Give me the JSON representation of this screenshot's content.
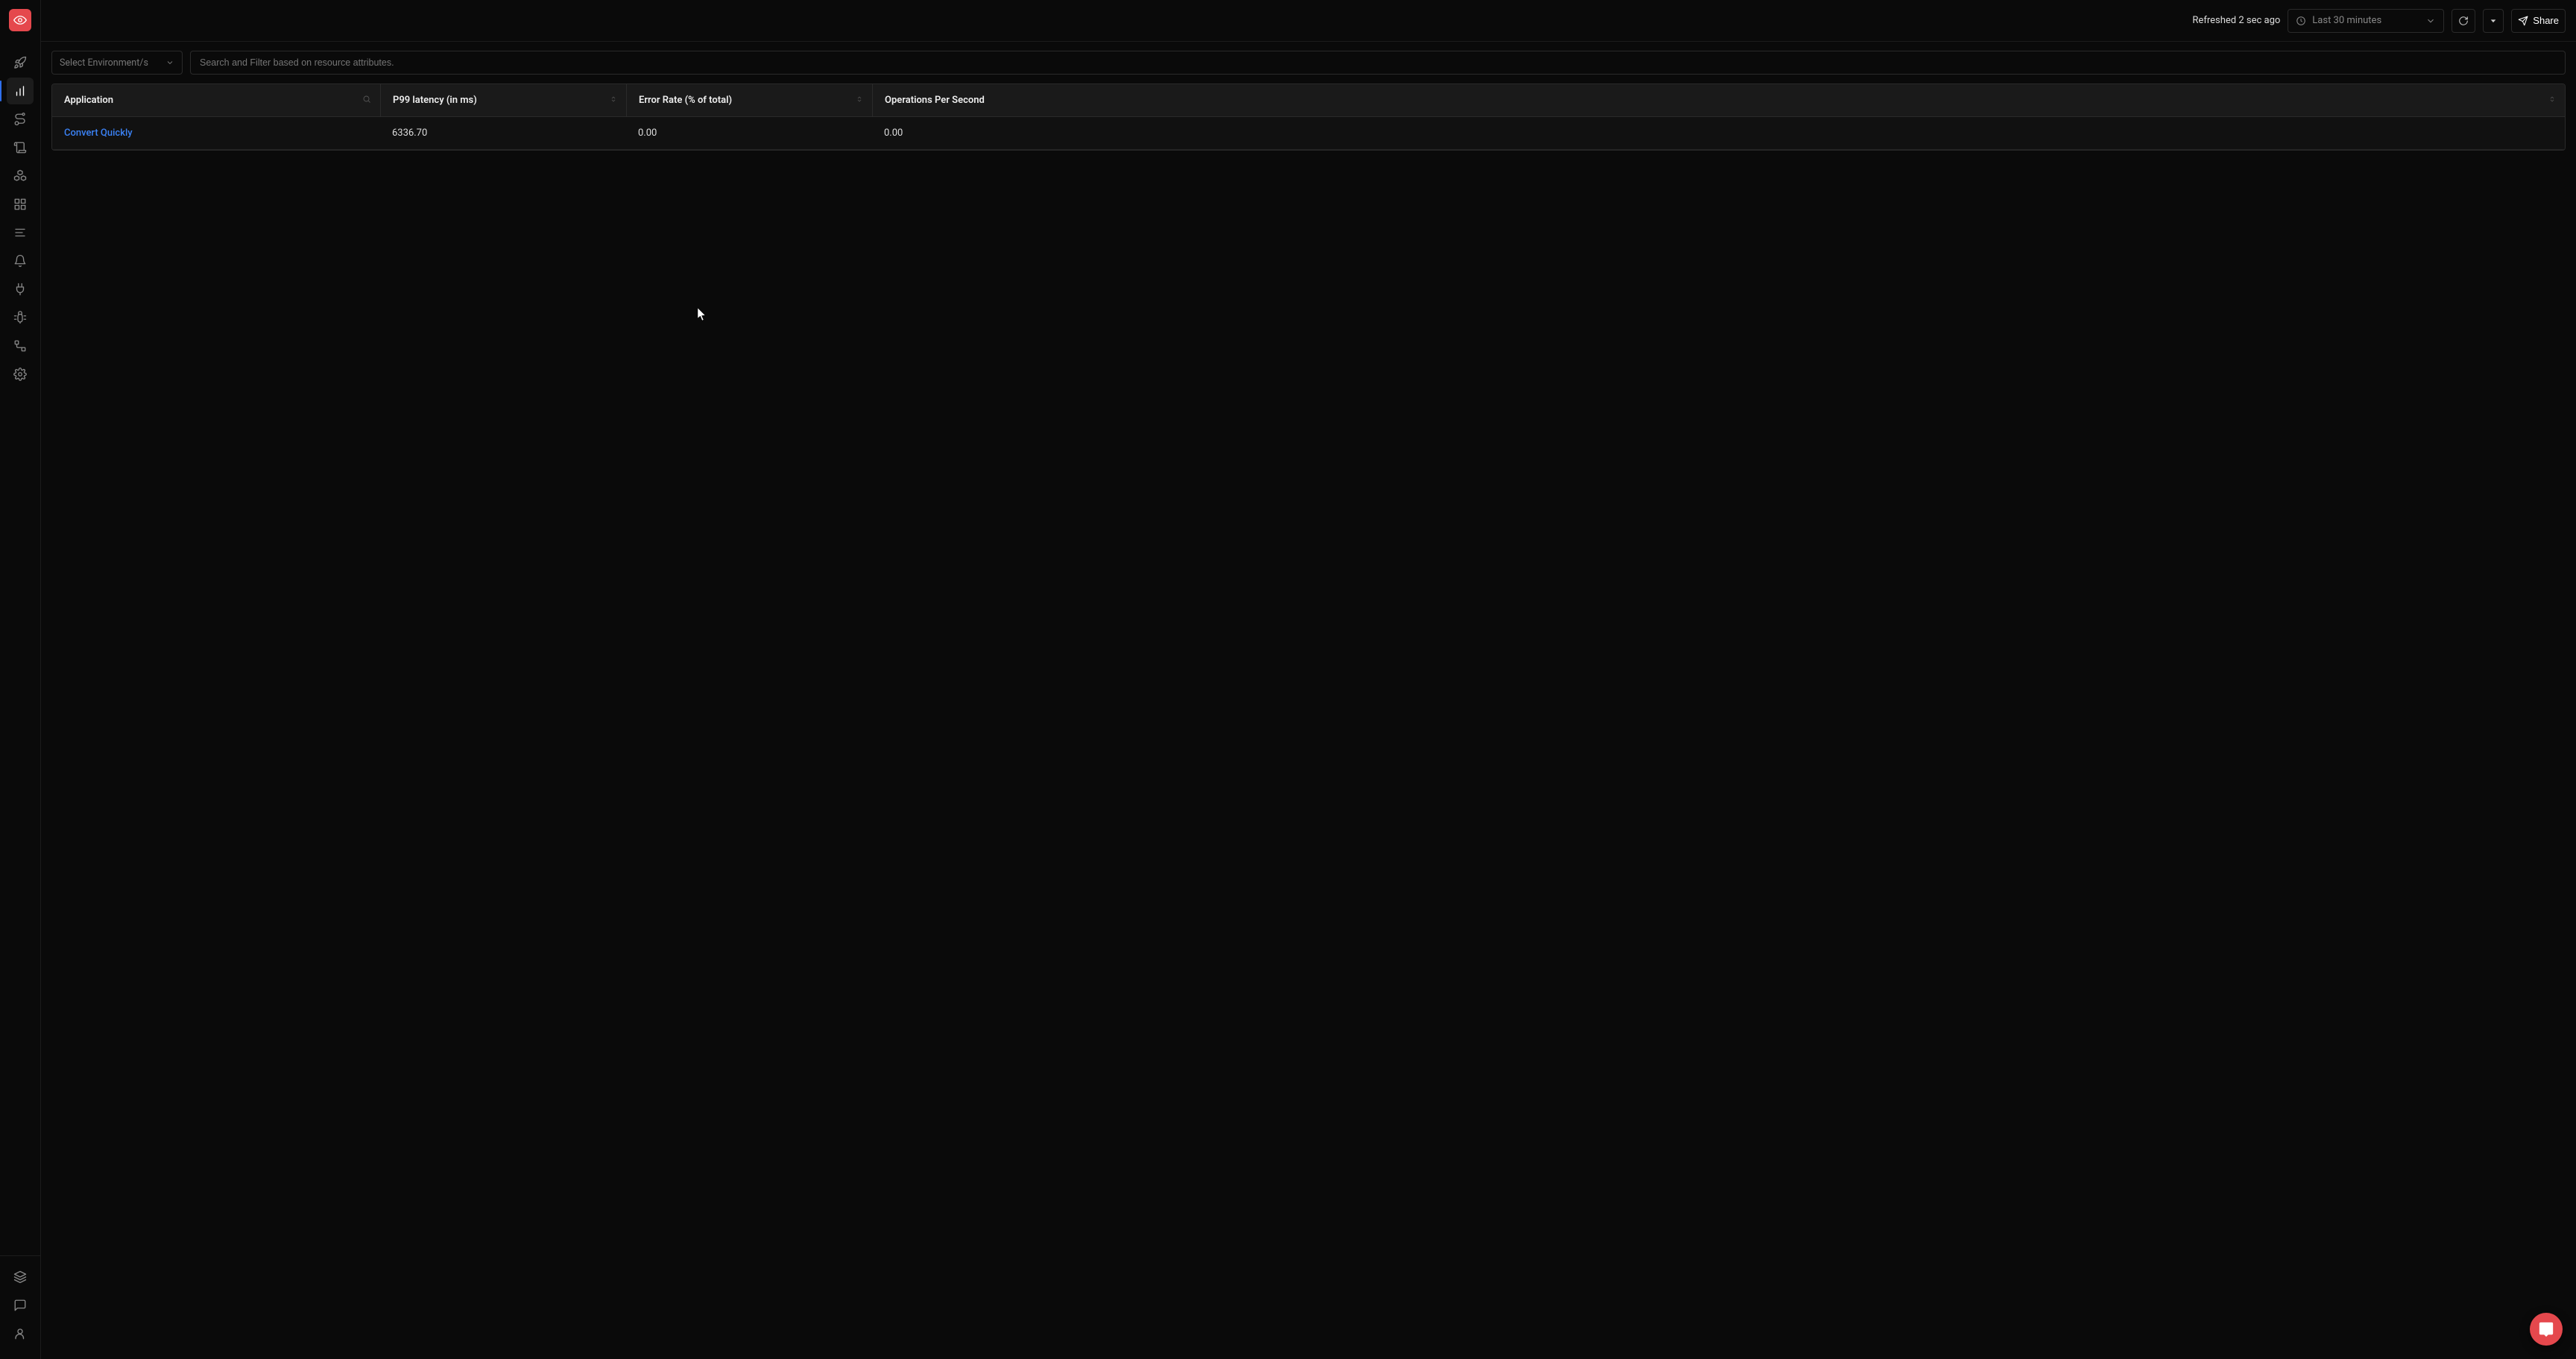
{
  "topbar": {
    "refreshed_text": "Refreshed 2 sec ago",
    "time_range_label": "Last 30 minutes",
    "share_label": "Share"
  },
  "filters": {
    "env_placeholder": "Select Environment/s",
    "search_placeholder": "Search and Filter based on resource attributes."
  },
  "table": {
    "columns": {
      "application": "Application",
      "p99": "P99 latency (in ms)",
      "error_rate": "Error Rate (% of total)",
      "ops": "Operations Per Second"
    },
    "rows": [
      {
        "application": "Convert Quickly",
        "p99": "6336.70",
        "error_rate": "0.00",
        "ops": "0.00"
      }
    ]
  },
  "sidebar": {
    "items": [
      {
        "name": "getting-started",
        "icon": "rocket"
      },
      {
        "name": "metrics",
        "icon": "bar-chart",
        "active": true
      },
      {
        "name": "traces",
        "icon": "route"
      },
      {
        "name": "logs",
        "icon": "scroll"
      },
      {
        "name": "services",
        "icon": "hexagons"
      },
      {
        "name": "dashboards",
        "icon": "grid"
      },
      {
        "name": "list-view",
        "icon": "list"
      },
      {
        "name": "alerts",
        "icon": "bell"
      },
      {
        "name": "integrations",
        "icon": "plug"
      },
      {
        "name": "exceptions",
        "icon": "bug"
      },
      {
        "name": "pipelines",
        "icon": "route2"
      },
      {
        "name": "settings",
        "icon": "gear"
      }
    ],
    "bottom_items": [
      {
        "name": "layers",
        "icon": "layers"
      },
      {
        "name": "feedback",
        "icon": "message"
      },
      {
        "name": "account",
        "icon": "user"
      }
    ]
  }
}
